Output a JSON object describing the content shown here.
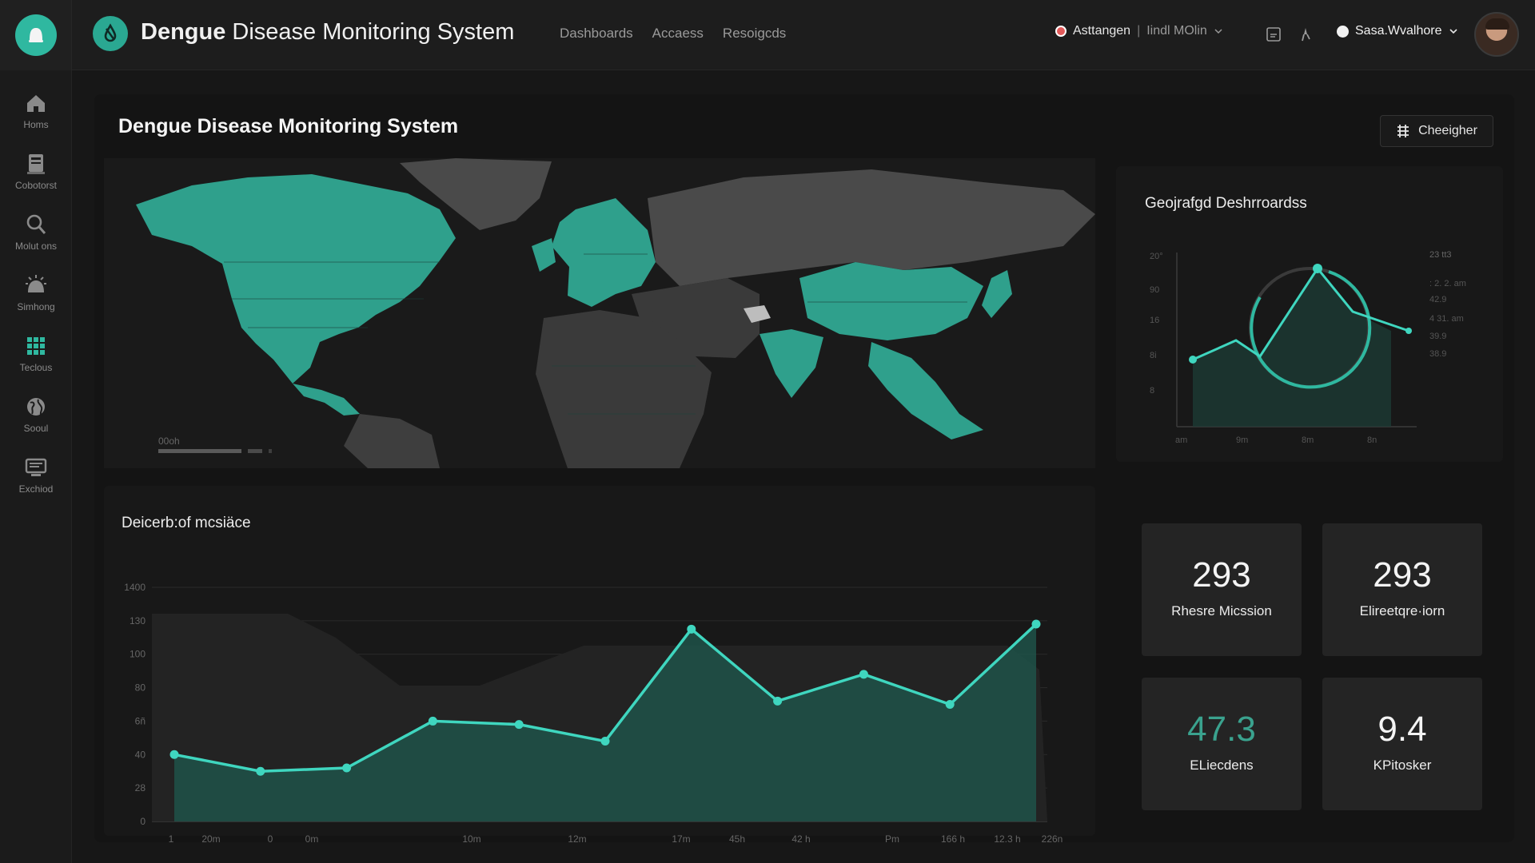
{
  "header": {
    "title_bold": "Dengue",
    "title_rest": "Disease  Monitoring System",
    "nav": [
      "Dashboards",
      "Accaess",
      "Resoigcds"
    ],
    "status_label": "Asttangen",
    "status_sub": "Iindl MOlin",
    "user_name": "Sasa.Wvalhore"
  },
  "sidebar": {
    "items": [
      {
        "label": "Homs",
        "icon": "home-icon"
      },
      {
        "label": "Cobotorst",
        "icon": "document-icon"
      },
      {
        "label": "Molut ons",
        "icon": "search-icon"
      },
      {
        "label": "Simhong",
        "icon": "alert-icon"
      },
      {
        "label": "Teclous",
        "icon": "grid-icon"
      },
      {
        "label": "Sooul",
        "icon": "globe-icon"
      },
      {
        "label": "Exchiod",
        "icon": "monitor-icon"
      }
    ]
  },
  "panel": {
    "title": "Dengue Disease Monitoring System",
    "action_label": "Cheeigher"
  },
  "map": {
    "scale_label": "00oh",
    "highlight_color": "#2fa08c"
  },
  "geo_chart": {
    "title": "Geojrafgd Deshrroardss",
    "y_ticks": [
      "20°",
      "90",
      "16",
      "8i",
      "8"
    ],
    "x_ticks": [
      "am",
      "9m",
      "8m",
      "8n"
    ],
    "side_labels": [
      "23 tt3",
      ": 2. 2. am",
      "42.9",
      "4 31. am",
      "39.9",
      "38.9"
    ]
  },
  "trend_chart": {
    "title": "Deicerb:of mcsiäce"
  },
  "chart_data": {
    "type": "area",
    "y_ticks": [
      "1400",
      "130",
      "100",
      "80",
      "6ñ",
      "40",
      "28",
      "0"
    ],
    "x_ticks": [
      "1",
      "20m",
      "0",
      "0m",
      "10m",
      "12m",
      "17m",
      "45h",
      "42 h",
      "Pm",
      "166 h",
      "12.3 h",
      "226n"
    ],
    "ylim": [
      0,
      140
    ],
    "series": [
      {
        "values": [
          40,
          30,
          32,
          60,
          58,
          48,
          115,
          72,
          88,
          70,
          118
        ]
      }
    ]
  },
  "stats": [
    {
      "value": "293",
      "label": "Rhesre Micssion"
    },
    {
      "value": "293",
      "label": "Elireetqre·iorn"
    },
    {
      "value": "47.3",
      "label": "ELiecdens"
    },
    {
      "value": "9.4",
      "label": "KPitosker"
    }
  ],
  "colors": {
    "accent": "#2fb8a0",
    "line": "#3fd6bf",
    "area": "#1f5a4f"
  }
}
